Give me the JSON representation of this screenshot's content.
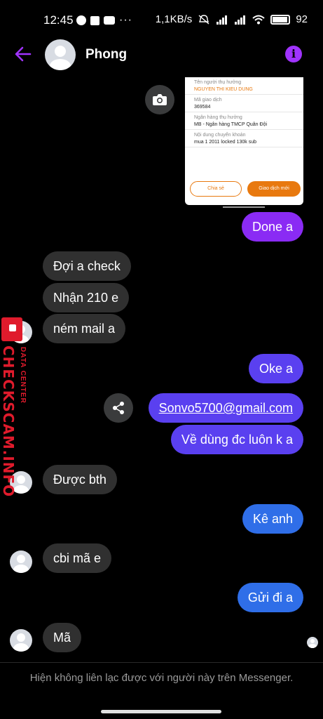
{
  "status_bar": {
    "time": "12:45",
    "more": "···",
    "net_speed": "1,1KB/s",
    "battery": "92"
  },
  "header": {
    "contact_name": "Phong",
    "back_icon": "arrow-left-icon",
    "info_icon": "info-icon",
    "accent_color": "#a033ff"
  },
  "receipt": {
    "recipient_label": "Tên người thụ hưởng",
    "recipient_value": "NGUYEN THI KIEU DUNG",
    "txn_label": "Mã giao dịch",
    "txn_value": "369584",
    "bank_label": "Ngân hàng thụ hưởng",
    "bank_value": "MB - Ngân hàng TMCP Quân Đội",
    "content_label": "Nội dung chuyển khoản",
    "content_value": "mua 1 2011 locked 130k sub",
    "share_button": "Chia sẻ",
    "new_txn_button": "Giao dịch mới"
  },
  "messages": [
    {
      "direction": "out",
      "text": "Done a"
    },
    {
      "direction": "in",
      "text": "Đợi a check"
    },
    {
      "direction": "in",
      "text": "Nhận 210 e"
    },
    {
      "direction": "in",
      "text": "ném mail a"
    },
    {
      "direction": "out",
      "text": "Oke a"
    },
    {
      "direction": "out",
      "text": "Sonvo5700@gmail.com"
    },
    {
      "direction": "out",
      "text": "Về dùng đc luôn k a"
    },
    {
      "direction": "in",
      "text": "Được bth"
    },
    {
      "direction": "out",
      "text": "Kê anh"
    },
    {
      "direction": "in",
      "text": "cbi mã e"
    },
    {
      "direction": "out",
      "text": "Gửi đi a"
    },
    {
      "direction": "in",
      "text": "Mã"
    }
  ],
  "watermark": {
    "main": "CHECKSCAM.INFO",
    "sub": "DATA CENTER"
  },
  "footer": {
    "notice": "Hiện không liên lạc được với người này trên Messenger."
  }
}
